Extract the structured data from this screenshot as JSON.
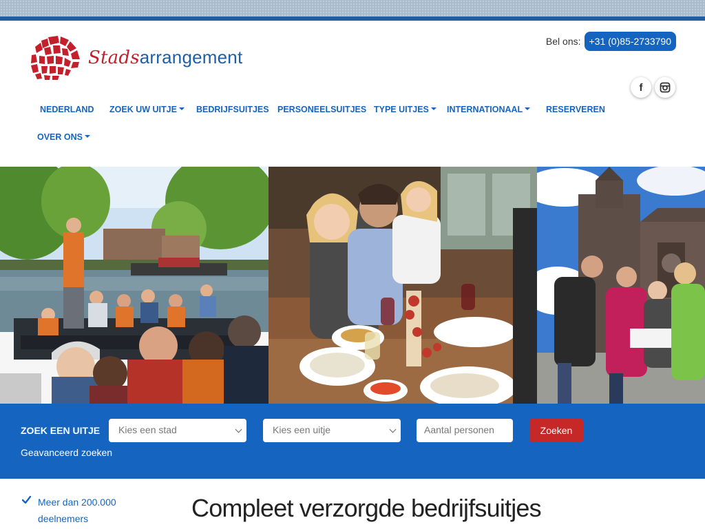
{
  "brand": {
    "logo_part1": "Stads",
    "logo_part2": "arrangement",
    "logo_icon": "red-mosaic-circle-icon",
    "colors": {
      "primary": "#1565c0",
      "accent": "#c3202c",
      "button_red": "#c62828"
    }
  },
  "contact": {
    "label": "Bel ons:",
    "phone": "+31 (0)85-2733790"
  },
  "social": {
    "facebook_glyph": "f",
    "facebook_icon": "facebook-icon",
    "instagram_icon": "instagram-icon"
  },
  "nav": {
    "items": [
      {
        "label": "NEDERLAND",
        "dropdown": false
      },
      {
        "label": "ZOEK UW UITJE",
        "dropdown": true
      },
      {
        "label": "BEDRIJFSUITJES",
        "dropdown": false
      },
      {
        "label": "PERSONEELSUITJES",
        "dropdown": false
      },
      {
        "label": "TYPE UITJES",
        "dropdown": true
      },
      {
        "label": "INTERNATIONAAL",
        "dropdown": true
      },
      {
        "label": "RESERVEREN",
        "dropdown": false
      },
      {
        "label": "OVER ONS",
        "dropdown": true
      }
    ]
  },
  "hero": {
    "images": [
      {
        "icon": "canal-boat-tour-photo"
      },
      {
        "icon": "group-dinner-photo"
      },
      {
        "icon": "city-tour-church-photo"
      }
    ]
  },
  "search": {
    "title": "ZOEK EEN UITJE",
    "city_select": "Kies een stad",
    "activity_select": "Kies een uitje",
    "persons_placeholder": "Aantal personen",
    "submit_label": "Zoeken",
    "advanced_link": "Geavanceerd zoeken"
  },
  "content": {
    "usp_line1": "Meer dan 200.000",
    "usp_line2": "deelnemers",
    "headline": "Compleet verzorgde bedrijfsuitjes"
  }
}
